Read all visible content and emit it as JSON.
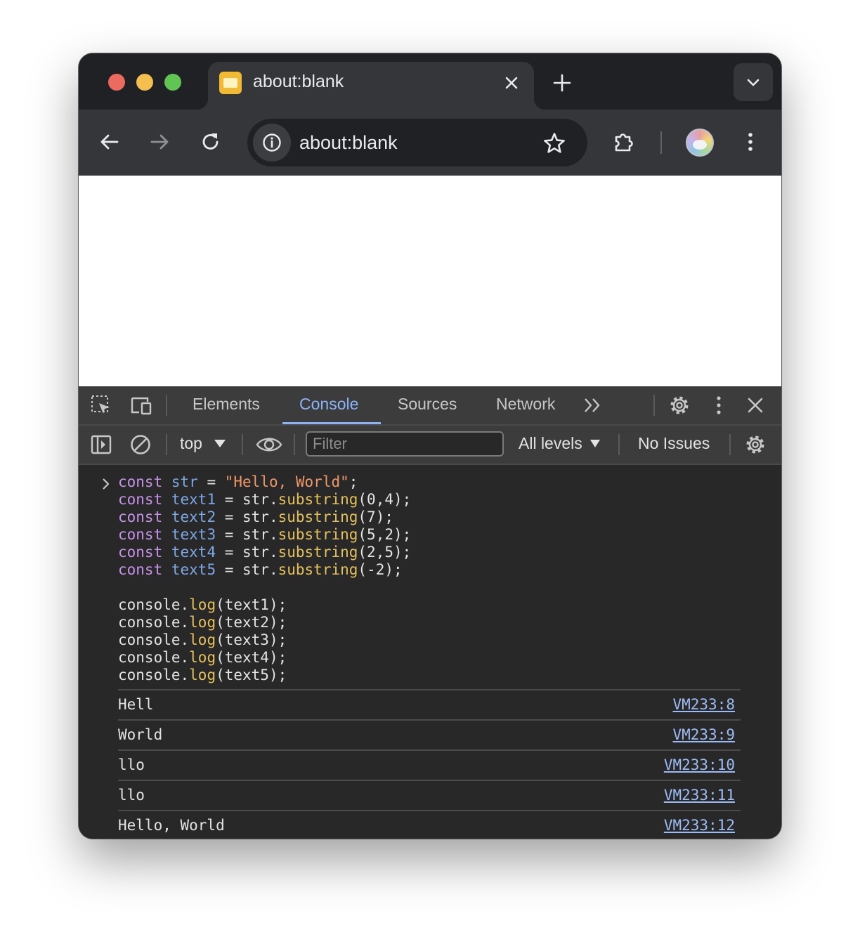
{
  "browser": {
    "tab": {
      "title": "about:blank"
    },
    "toolbar": {
      "url": "about:blank"
    }
  },
  "devtools": {
    "tabs": [
      "Elements",
      "Console",
      "Sources",
      "Network"
    ],
    "active_tab": "Console",
    "console_toolbar": {
      "context": "top",
      "filter_placeholder": "Filter",
      "levels": "All levels",
      "issues": "No Issues"
    },
    "input_code": [
      "const str = \"Hello, World\";",
      "const text1 = str.substring(0,4);",
      "const text2 = str.substring(7);",
      "const text3 = str.substring(5,2);",
      "const text4 = str.substring(2,5);",
      "const text5 = str.substring(-2);",
      "",
      "console.log(text1);",
      "console.log(text2);",
      "console.log(text3);",
      "console.log(text4);",
      "console.log(text5);"
    ],
    "outputs": [
      {
        "text": "Hell",
        "source": "VM233:8"
      },
      {
        "text": "World",
        "source": "VM233:9"
      },
      {
        "text": "llo",
        "source": "VM233:10"
      },
      {
        "text": "llo",
        "source": "VM233:11"
      },
      {
        "text": "Hello, World",
        "source": "VM233:12"
      }
    ]
  },
  "colors": {
    "tab_active_bg": "#35363a",
    "titlebar_bg": "#202124",
    "devtools_accent": "#8ab4f8",
    "syntax_keyword": "#c792ea",
    "syntax_variable": "#7ca8e6",
    "syntax_string": "#f29766",
    "syntax_function": "#e5c15a"
  }
}
